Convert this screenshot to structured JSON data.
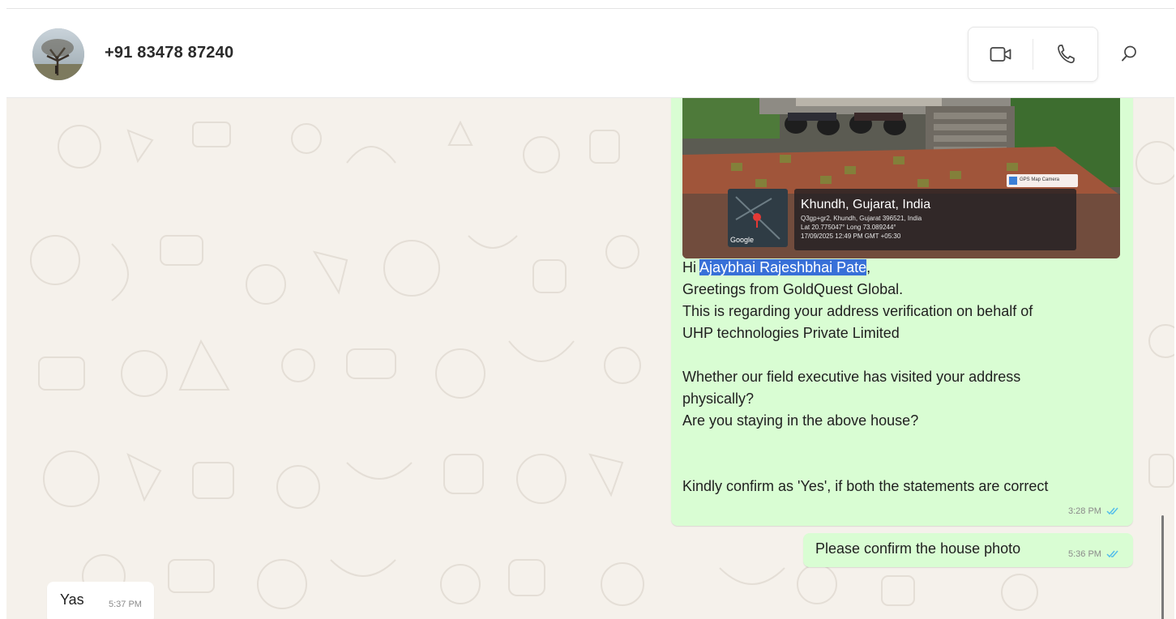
{
  "header": {
    "contact_name": "+91 83478 87240",
    "icons": [
      "avatar",
      "video-call-icon",
      "voice-call-icon",
      "search-icon"
    ]
  },
  "messages": [
    {
      "direction": "outgoing",
      "photo": {
        "location_title": "Khundh, Gujarat, India",
        "address_line": "Q3gp+gr2, Khundh, Gujarat 396521, India",
        "coords_line": "Lat 20.775047° Long 73.089244°",
        "datetime_line": "17/09/2025 12:49 PM GMT +05:30",
        "app_badge": "GPS Map Camera",
        "map_label": "Google"
      },
      "greeting_prefix": "Hi ",
      "highlighted_name": "Ajaybhai Rajeshbhai Pate",
      "greeting_suffix": ",",
      "body": "Greetings from GoldQuest Global.\nThis is regarding your address verification on behalf of\nUHP technologies Private Limited\n\nWhether our field executive has visited your address\nphysically?\nAre you staying in the above house?\n\n\nKindly confirm as 'Yes', if both the statements are correct",
      "time": "3:28 PM",
      "status": "read"
    },
    {
      "direction": "outgoing",
      "text": "Please confirm the house photo",
      "time": "5:36 PM",
      "status": "read"
    },
    {
      "direction": "incoming",
      "text": "Yas",
      "time": "5:37 PM"
    }
  ],
  "colors": {
    "outgoing_bubble": "#d9fdd3",
    "incoming_bubble": "#ffffff",
    "chat_background": "#f5f1eb",
    "read_ticks": "#53bdeb",
    "selection_highlight": "#3870d8"
  }
}
